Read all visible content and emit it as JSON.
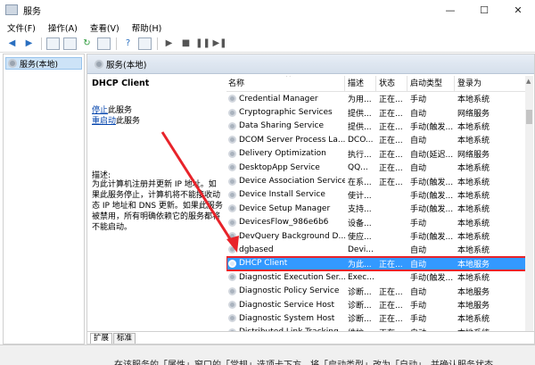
{
  "window": {
    "title": "服务",
    "controls": {
      "minimize": "—",
      "maximize": "☐",
      "close": "✕"
    }
  },
  "menubar": [
    "文件(F)",
    "操作(A)",
    "查看(V)",
    "帮助(H)"
  ],
  "toolbar": {
    "icons": [
      "back-arrow-icon",
      "forward-arrow-icon",
      "view-icon",
      "export-icon",
      "refresh-icon",
      "list-icon",
      "help-icon",
      "properties-icon",
      "play-icon",
      "stop-icon",
      "pause-icon",
      "restart-icon"
    ]
  },
  "tree": {
    "selected": "服务(本地)"
  },
  "main": {
    "header": "服务(本地)",
    "detail": {
      "service_name": "DHCP Client",
      "stop_link": "停止",
      "stop_suffix": "此服务",
      "restart_link": "重启动",
      "restart_suffix": "此服务",
      "desc_label": "描述:",
      "desc_text": "为此计算机注册并更新 IP 地址。如果此服务停止，计算机将不能接收动态 IP 地址和 DNS 更新。如果此服务被禁用，所有明确依赖它的服务都将不能启动。"
    },
    "columns": {
      "name": "名称",
      "desc": "描述",
      "status": "状态",
      "startup": "启动类型",
      "logon": "登录为"
    },
    "rows": [
      {
        "name": "Credential Manager",
        "desc": "为用...",
        "status": "正在...",
        "startup": "手动",
        "logon": "本地系统"
      },
      {
        "name": "Cryptographic Services",
        "desc": "提供...",
        "status": "正在...",
        "startup": "自动",
        "logon": "网络服务"
      },
      {
        "name": "Data Sharing Service",
        "desc": "提供...",
        "status": "正在...",
        "startup": "手动(触发...",
        "logon": "本地系统"
      },
      {
        "name": "DCOM Server Process La...",
        "desc": "DCO...",
        "status": "正在...",
        "startup": "自动",
        "logon": "本地系统"
      },
      {
        "name": "Delivery Optimization",
        "desc": "执行...",
        "status": "正在...",
        "startup": "自动(延迟...",
        "logon": "网络服务"
      },
      {
        "name": "DesktopApp Service",
        "desc": "QQ...",
        "status": "正在...",
        "startup": "自动",
        "logon": "本地系统"
      },
      {
        "name": "Device Association Service",
        "desc": "在系...",
        "status": "正在...",
        "startup": "手动(触发...",
        "logon": "本地系统"
      },
      {
        "name": "Device Install Service",
        "desc": "使计...",
        "status": "",
        "startup": "手动(触发...",
        "logon": "本地系统"
      },
      {
        "name": "Device Setup Manager",
        "desc": "支持...",
        "status": "",
        "startup": "手动(触发...",
        "logon": "本地系统"
      },
      {
        "name": "DevicesFlow_986e6b6",
        "desc": "设备...",
        "status": "",
        "startup": "手动",
        "logon": "本地系统"
      },
      {
        "name": "DevQuery Background D...",
        "desc": "使应...",
        "status": "",
        "startup": "手动(触发...",
        "logon": "本地系统"
      },
      {
        "name": "dgbased",
        "desc": "Devi...",
        "status": "",
        "startup": "自动",
        "logon": "本地系统"
      },
      {
        "name": "DHCP Client",
        "desc": "为此...",
        "status": "正在...",
        "startup": "自动",
        "logon": "本地服务",
        "selected": true
      },
      {
        "name": "Diagnostic Execution Ser...",
        "desc": "Exec...",
        "status": "",
        "startup": "手动(触发...",
        "logon": "本地系统"
      },
      {
        "name": "Diagnostic Policy Service",
        "desc": "诊断...",
        "status": "正在...",
        "startup": "自动",
        "logon": "本地服务"
      },
      {
        "name": "Diagnostic Service Host",
        "desc": "诊断...",
        "status": "正在...",
        "startup": "手动",
        "logon": "本地服务"
      },
      {
        "name": "Diagnostic System Host",
        "desc": "诊断...",
        "status": "正在...",
        "startup": "手动",
        "logon": "本地系统"
      },
      {
        "name": "Distributed Link Tracking...",
        "desc": "维护...",
        "status": "正在...",
        "startup": "自动",
        "logon": "本地系统"
      }
    ],
    "tabs": [
      "扩展",
      "标准"
    ]
  },
  "status_text": "在该服务的「属性」窗口的「常规」选项卡下方，将「启动类型」改为「自动」，并确认服务状态",
  "colors": {
    "selection": "#3399ff",
    "annotation": "#e8232a",
    "link": "#0645ad"
  }
}
